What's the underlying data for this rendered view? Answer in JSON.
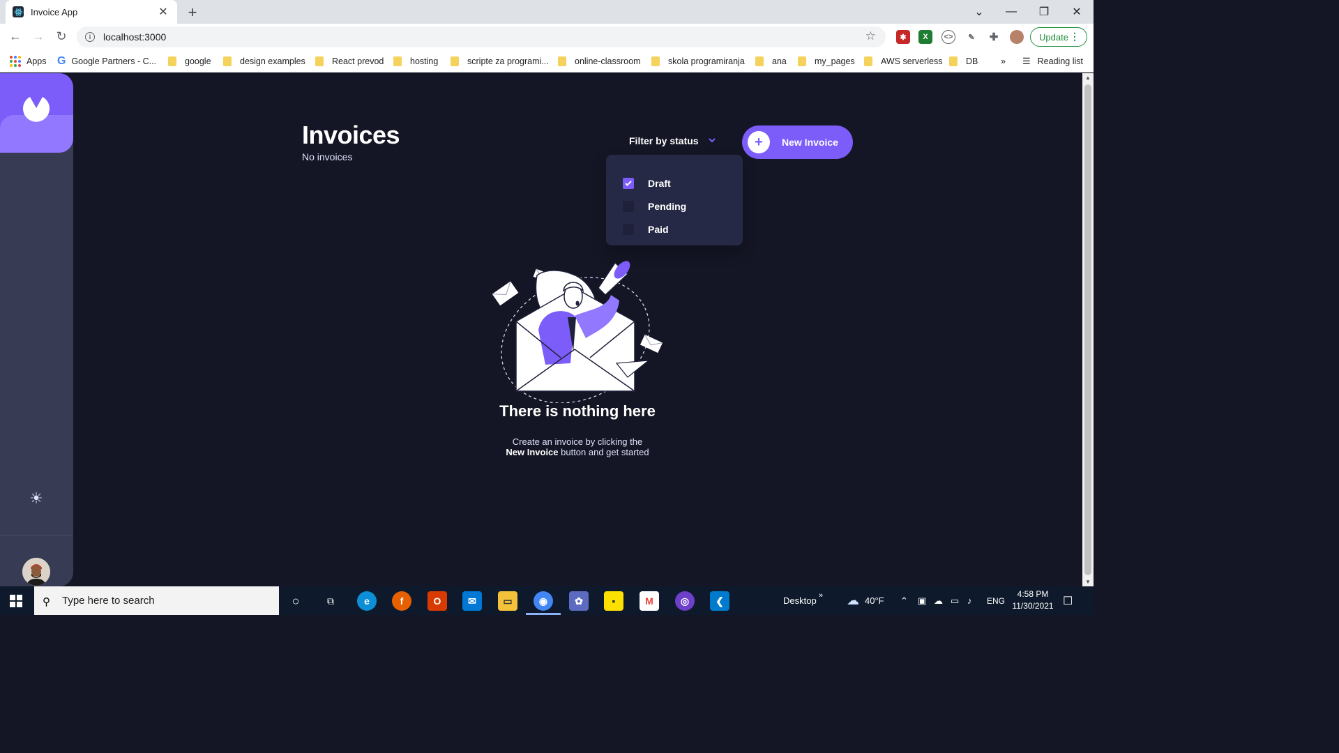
{
  "browser": {
    "tab_title": "Invoice App",
    "url": "localhost:3000",
    "update_label": "Update",
    "bookmarks": [
      {
        "label": "Apps",
        "icon": "apps-grid-icon"
      },
      {
        "label": "Google Partners - C...",
        "icon": "google-icon"
      },
      {
        "label": "google",
        "icon": "folder-icon"
      },
      {
        "label": "design examples",
        "icon": "folder-icon"
      },
      {
        "label": "React prevod",
        "icon": "folder-icon"
      },
      {
        "label": "hosting",
        "icon": "folder-icon"
      },
      {
        "label": "scripte za programi...",
        "icon": "folder-icon"
      },
      {
        "label": "online-classroom",
        "icon": "folder-icon"
      },
      {
        "label": "skola programiranja",
        "icon": "folder-icon"
      },
      {
        "label": "ana",
        "icon": "folder-icon"
      },
      {
        "label": "my_pages",
        "icon": "folder-icon"
      },
      {
        "label": "AWS serverless",
        "icon": "folder-icon"
      },
      {
        "label": "DB",
        "icon": "folder-icon"
      }
    ],
    "bookmarks_overflow": "»",
    "reading_list": "Reading list"
  },
  "app": {
    "title": "Invoices",
    "subtitle": "No invoices",
    "filter_label": "Filter by status",
    "new_invoice_label": "New Invoice",
    "filter_options": [
      {
        "label": "Draft",
        "checked": true
      },
      {
        "label": "Pending",
        "checked": false
      },
      {
        "label": "Paid",
        "checked": false
      }
    ],
    "empty": {
      "title": "There is nothing here",
      "line1": "Create an invoice by clicking the",
      "line2_bold": "New Invoice",
      "line2_rest": " button and get started"
    },
    "colors": {
      "accent": "#7c5dfa",
      "accent_light": "#9277ff",
      "sidebar": "#373b53",
      "background": "#141625",
      "dropdown": "#252945"
    }
  },
  "taskbar": {
    "search_placeholder": "Type here to search",
    "desktop_label": "Desktop",
    "weather": "40°F",
    "language": "ENG",
    "time": "4:58 PM",
    "date": "11/30/2021"
  }
}
